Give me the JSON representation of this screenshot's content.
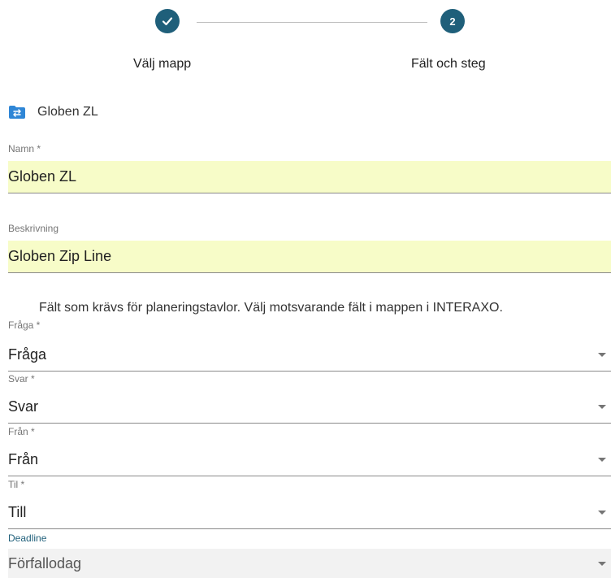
{
  "stepper": {
    "step1": {
      "label": "Välj mapp",
      "icon": "check-icon"
    },
    "step2": {
      "number": "2",
      "label": "Fält och steg"
    }
  },
  "folder": {
    "icon": "folder-sync-icon",
    "name": "Globen ZL"
  },
  "fields": {
    "namn": {
      "label": "Namn *",
      "value": "Globen ZL"
    },
    "beskrivning": {
      "label": "Beskrivning",
      "value": "Globen Zip Line"
    }
  },
  "info": "Fält som krävs för planeringstavlor. Välj motsvarande fält i mappen i INTERAXO.",
  "selects": {
    "fraga": {
      "label": "Fråga *",
      "value": "Fråga"
    },
    "svar": {
      "label": "Svar *",
      "value": "Svar"
    },
    "fran": {
      "label": "Från *",
      "value": "Från"
    },
    "till": {
      "label": "Til *",
      "value": "Till"
    },
    "deadline": {
      "label": "Deadline",
      "value": "Förfallodag"
    }
  },
  "colors": {
    "accent": "#1f5f7a",
    "input_highlight": "#f7fcc8",
    "folder_icon": "#2f86d6"
  }
}
